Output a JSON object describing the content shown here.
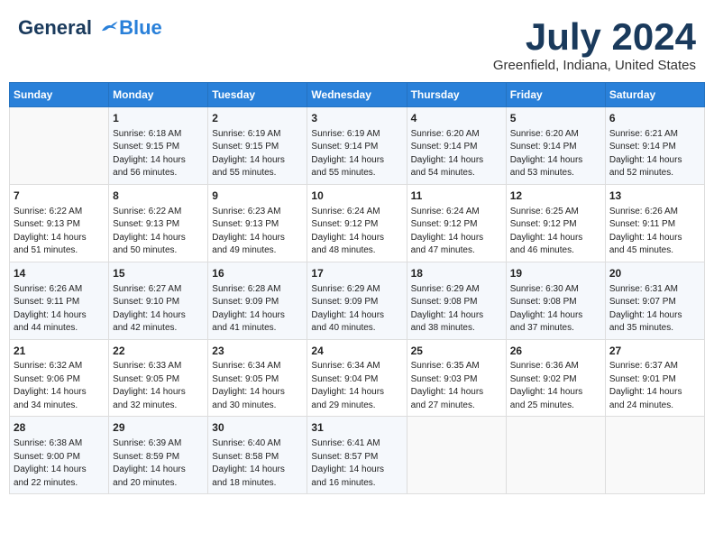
{
  "header": {
    "logo_general": "General",
    "logo_blue": "Blue",
    "month_title": "July 2024",
    "location": "Greenfield, Indiana, United States"
  },
  "weekdays": [
    "Sunday",
    "Monday",
    "Tuesday",
    "Wednesday",
    "Thursday",
    "Friday",
    "Saturday"
  ],
  "weeks": [
    [
      {
        "day": null
      },
      {
        "day": "1",
        "sunrise": "6:18 AM",
        "sunset": "9:15 PM",
        "daylight": "14 hours and 56 minutes."
      },
      {
        "day": "2",
        "sunrise": "6:19 AM",
        "sunset": "9:15 PM",
        "daylight": "14 hours and 55 minutes."
      },
      {
        "day": "3",
        "sunrise": "6:19 AM",
        "sunset": "9:14 PM",
        "daylight": "14 hours and 55 minutes."
      },
      {
        "day": "4",
        "sunrise": "6:20 AM",
        "sunset": "9:14 PM",
        "daylight": "14 hours and 54 minutes."
      },
      {
        "day": "5",
        "sunrise": "6:20 AM",
        "sunset": "9:14 PM",
        "daylight": "14 hours and 53 minutes."
      },
      {
        "day": "6",
        "sunrise": "6:21 AM",
        "sunset": "9:14 PM",
        "daylight": "14 hours and 52 minutes."
      }
    ],
    [
      {
        "day": "7",
        "sunrise": "6:22 AM",
        "sunset": "9:13 PM",
        "daylight": "14 hours and 51 minutes."
      },
      {
        "day": "8",
        "sunrise": "6:22 AM",
        "sunset": "9:13 PM",
        "daylight": "14 hours and 50 minutes."
      },
      {
        "day": "9",
        "sunrise": "6:23 AM",
        "sunset": "9:13 PM",
        "daylight": "14 hours and 49 minutes."
      },
      {
        "day": "10",
        "sunrise": "6:24 AM",
        "sunset": "9:12 PM",
        "daylight": "14 hours and 48 minutes."
      },
      {
        "day": "11",
        "sunrise": "6:24 AM",
        "sunset": "9:12 PM",
        "daylight": "14 hours and 47 minutes."
      },
      {
        "day": "12",
        "sunrise": "6:25 AM",
        "sunset": "9:12 PM",
        "daylight": "14 hours and 46 minutes."
      },
      {
        "day": "13",
        "sunrise": "6:26 AM",
        "sunset": "9:11 PM",
        "daylight": "14 hours and 45 minutes."
      }
    ],
    [
      {
        "day": "14",
        "sunrise": "6:26 AM",
        "sunset": "9:11 PM",
        "daylight": "14 hours and 44 minutes."
      },
      {
        "day": "15",
        "sunrise": "6:27 AM",
        "sunset": "9:10 PM",
        "daylight": "14 hours and 42 minutes."
      },
      {
        "day": "16",
        "sunrise": "6:28 AM",
        "sunset": "9:09 PM",
        "daylight": "14 hours and 41 minutes."
      },
      {
        "day": "17",
        "sunrise": "6:29 AM",
        "sunset": "9:09 PM",
        "daylight": "14 hours and 40 minutes."
      },
      {
        "day": "18",
        "sunrise": "6:29 AM",
        "sunset": "9:08 PM",
        "daylight": "14 hours and 38 minutes."
      },
      {
        "day": "19",
        "sunrise": "6:30 AM",
        "sunset": "9:08 PM",
        "daylight": "14 hours and 37 minutes."
      },
      {
        "day": "20",
        "sunrise": "6:31 AM",
        "sunset": "9:07 PM",
        "daylight": "14 hours and 35 minutes."
      }
    ],
    [
      {
        "day": "21",
        "sunrise": "6:32 AM",
        "sunset": "9:06 PM",
        "daylight": "14 hours and 34 minutes."
      },
      {
        "day": "22",
        "sunrise": "6:33 AM",
        "sunset": "9:05 PM",
        "daylight": "14 hours and 32 minutes."
      },
      {
        "day": "23",
        "sunrise": "6:34 AM",
        "sunset": "9:05 PM",
        "daylight": "14 hours and 30 minutes."
      },
      {
        "day": "24",
        "sunrise": "6:34 AM",
        "sunset": "9:04 PM",
        "daylight": "14 hours and 29 minutes."
      },
      {
        "day": "25",
        "sunrise": "6:35 AM",
        "sunset": "9:03 PM",
        "daylight": "14 hours and 27 minutes."
      },
      {
        "day": "26",
        "sunrise": "6:36 AM",
        "sunset": "9:02 PM",
        "daylight": "14 hours and 25 minutes."
      },
      {
        "day": "27",
        "sunrise": "6:37 AM",
        "sunset": "9:01 PM",
        "daylight": "14 hours and 24 minutes."
      }
    ],
    [
      {
        "day": "28",
        "sunrise": "6:38 AM",
        "sunset": "9:00 PM",
        "daylight": "14 hours and 22 minutes."
      },
      {
        "day": "29",
        "sunrise": "6:39 AM",
        "sunset": "8:59 PM",
        "daylight": "14 hours and 20 minutes."
      },
      {
        "day": "30",
        "sunrise": "6:40 AM",
        "sunset": "8:58 PM",
        "daylight": "14 hours and 18 minutes."
      },
      {
        "day": "31",
        "sunrise": "6:41 AM",
        "sunset": "8:57 PM",
        "daylight": "14 hours and 16 minutes."
      },
      {
        "day": null
      },
      {
        "day": null
      },
      {
        "day": null
      }
    ]
  ],
  "labels": {
    "sunrise": "Sunrise:",
    "sunset": "Sunset:",
    "daylight": "Daylight:"
  }
}
